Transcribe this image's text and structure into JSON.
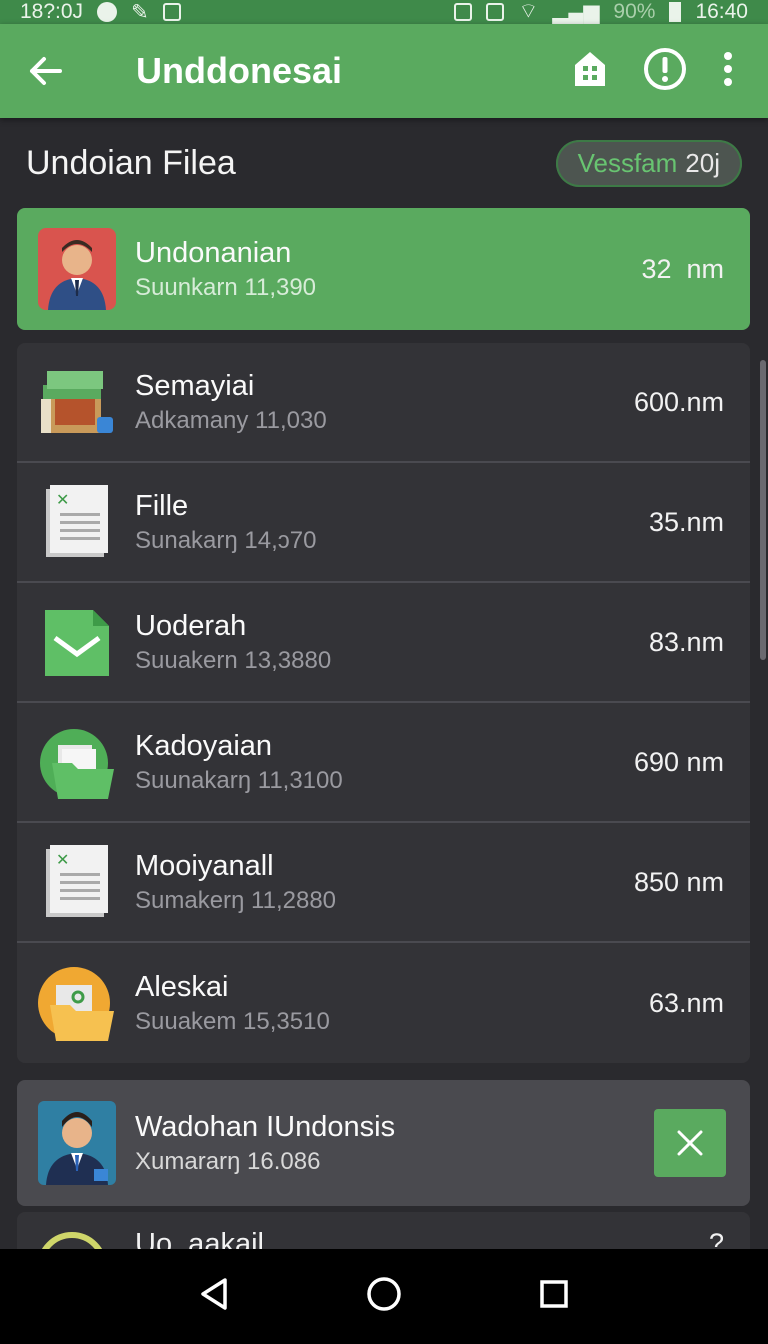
{
  "status_bar": {
    "left_time": "18?:0J",
    "battery": "90%",
    "clock": "16:40"
  },
  "app_bar": {
    "title": "Unddonesai",
    "icons": [
      "back-arrow-icon",
      "home-icon",
      "alert-icon",
      "more-vert-icon"
    ]
  },
  "subheader": {
    "title": "Undoian Filea",
    "badge_green": "Vessfam",
    "badge_num": "20j"
  },
  "highlighted_item": {
    "name": "Undonanian",
    "sub": "Suunkarn 11,390",
    "size": "32  nm",
    "icon": "person-avatar-icon"
  },
  "files": [
    {
      "name": "Semayiai",
      "sub": "Adkamany 11,030",
      "size": "600.nm",
      "icon": "books-stack-icon"
    },
    {
      "name": "Fille",
      "sub": "Sunakarŋ 14,ↄ70",
      "size": "35.nm",
      "icon": "document-icon"
    },
    {
      "name": "Uoderah",
      "sub": "Suuakern 13,3880",
      "size": "83.nm",
      "icon": "green-mail-file-icon"
    },
    {
      "name": "Kadoyaian",
      "sub": "Suunakarŋ 11,3100",
      "size": "690 nm",
      "icon": "green-folder-icon"
    },
    {
      "name": "Mooiyanall",
      "sub": "Sumakerŋ 11,2880",
      "size": "850 nm",
      "icon": "document-icon"
    },
    {
      "name": "Aleskai",
      "sub": "Suuakem 15,3510",
      "size": "63.nm",
      "icon": "orange-folder-icon"
    }
  ],
  "notification": {
    "name": "Wadohan IUndonsis",
    "sub": "Xumararŋ 16.086",
    "icon": "person-avatar-icon"
  },
  "partial_item": {
    "name": "Uo  aakail",
    "size": "?"
  },
  "colors": {
    "primary": "#5aaa5f",
    "status_bar": "#3f8a4a",
    "background": "#2a2a2e",
    "card": "#333337"
  }
}
